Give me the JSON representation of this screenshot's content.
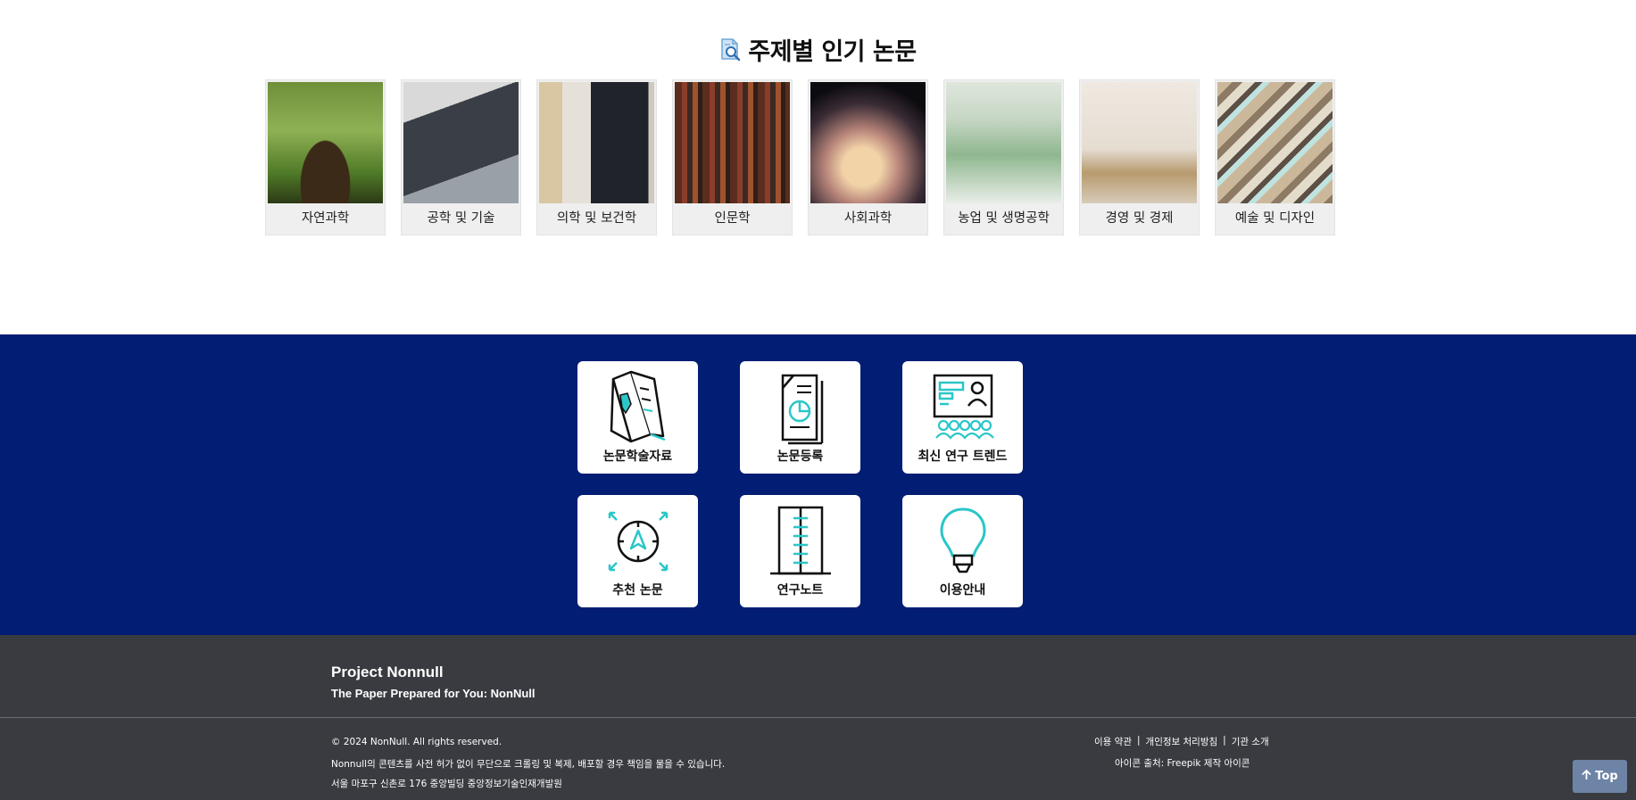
{
  "topics": {
    "title": "주제별 인기 논문",
    "title_icon": "search-document-icon",
    "cards": [
      {
        "label": "자연과학",
        "image": "seedling-photo"
      },
      {
        "label": "공학 및 기술",
        "image": "laptop-code-photo"
      },
      {
        "label": "의학 및 보건학",
        "image": "xray-monitor-photo"
      },
      {
        "label": "인문학",
        "image": "bookshelf-photo"
      },
      {
        "label": "사회과학",
        "image": "silhouettes-sunset-photo"
      },
      {
        "label": "농업 및 생명공학",
        "image": "lab-tubes-photo"
      },
      {
        "label": "경영 및 경제",
        "image": "coins-chart-photo"
      },
      {
        "label": "예술 및 디자인",
        "image": "color-swatches-photo"
      }
    ]
  },
  "menu": {
    "background": "#021d74",
    "accent": "#2ac6c8",
    "tiles": [
      {
        "label": "논문학술자료",
        "icon": "open-book-icon"
      },
      {
        "label": "논문등록",
        "icon": "document-chart-icon"
      },
      {
        "label": "최신 연구 트렌드",
        "icon": "presentation-audience-icon"
      },
      {
        "label": "추천 논문",
        "icon": "compass-icon"
      },
      {
        "label": "연구노트",
        "icon": "notebook-icon"
      },
      {
        "label": "이용안내",
        "icon": "lightbulb-icon"
      }
    ]
  },
  "footer": {
    "brand": "Project Nonnull",
    "tagline": "The Paper Prepared for You: NonNull",
    "copyright": "© 2024 NonNull. All rights reserved.",
    "notice": "Nonnull의 콘텐츠를 사전 허가 없이 무단으로 크롤링 및 복제, 배포할 경우 책임을 물을 수 있습니다.",
    "address": "서울 마포구 신촌로 176 중앙빌딩 중앙정보기술인재개발원",
    "links": [
      "이용 약관",
      "개인정보 처리방침",
      "기관 소개"
    ],
    "separator": "|",
    "icon_credit": "아이콘 출처: Freepik 제작 아이콘"
  },
  "top_button": {
    "label": "Top",
    "icon": "arrow-up-icon"
  }
}
